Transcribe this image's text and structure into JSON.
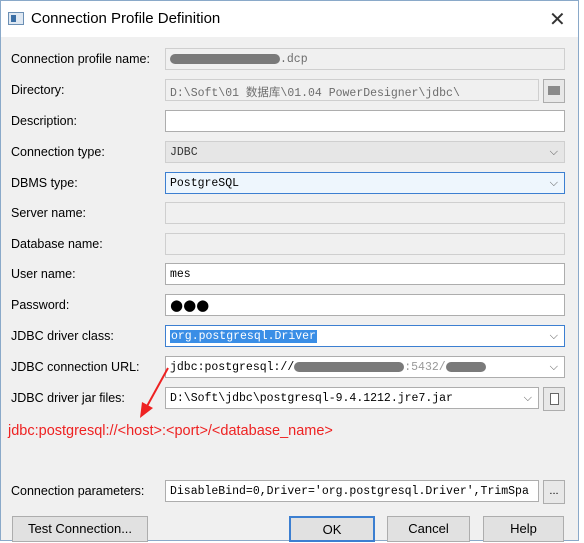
{
  "window": {
    "title": "Connection Profile Definition",
    "close_icon": "close-icon"
  },
  "fields": {
    "profile_name": {
      "label": "Connection profile name:",
      "value_suffix": ".dcp"
    },
    "directory": {
      "label": "Directory:",
      "value": "D:\\Soft\\01 数据库\\01.04 PowerDesigner\\jdbc\\"
    },
    "description": {
      "label": "Description:",
      "value": ""
    },
    "connection_type": {
      "label": "Connection type:",
      "value": "JDBC"
    },
    "dbms_type": {
      "label": "DBMS type:",
      "value": "PostgreSQL"
    },
    "server_name": {
      "label": "Server name:",
      "value": ""
    },
    "database_name": {
      "label": "Database name:",
      "value": ""
    },
    "user_name": {
      "label": "User name:",
      "value": "mes"
    },
    "password": {
      "label": "Password:",
      "value": "●●●"
    },
    "driver_class": {
      "label": "JDBC driver class:",
      "value": "org.postgresql.Driver"
    },
    "connection_url": {
      "label": "JDBC connection URL:",
      "value_prefix": "jdbc:postgresql://",
      "value_mid": ":5432/"
    },
    "driver_jar": {
      "label": "JDBC driver jar files:",
      "value": "D:\\Soft\\jdbc\\postgresql-9.4.1212.jre7.jar"
    },
    "connection_params": {
      "label": "Connection parameters:",
      "value": "DisableBind=0,Driver='org.postgresql.Driver',TrimSpa"
    }
  },
  "annotation": "jdbc:postgresql://<host>:<port>/<database_name>",
  "annotation_color": "#ee2222",
  "buttons": {
    "test": "Test Connection...",
    "ok": "OK",
    "cancel": "Cancel",
    "help": "Help",
    "ellipsis": "..."
  }
}
